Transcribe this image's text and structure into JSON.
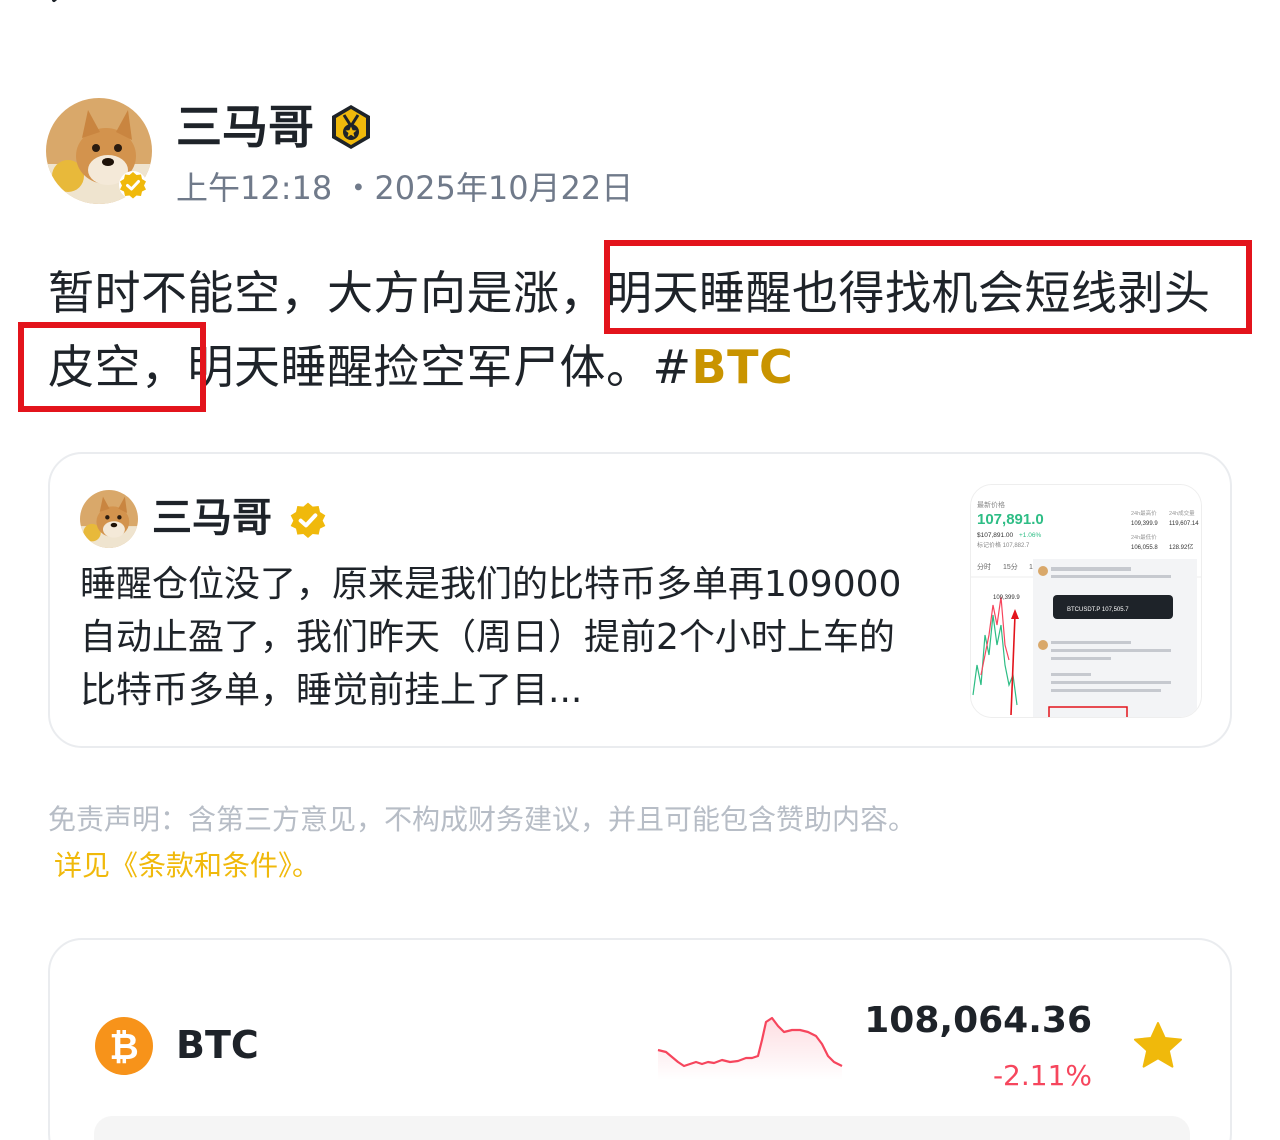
{
  "nav": {
    "back_icon": "chevron-left-icon"
  },
  "post": {
    "author": "三马哥",
    "author_badge_icon": "medal-icon",
    "verified_icon": "verified-check-icon",
    "time": "上午12:18 ・2025年10月22日",
    "body_text": "暂时不能空，大方向是涨，明天睡醒也得找机会短线剥头皮空，明天睡醒捡空军尸体。#",
    "hashtag": "BTC"
  },
  "quote": {
    "author": "三马哥",
    "text": "睡醒仓位没了，原来是我们的比特币多单再109000自动止盈了，我们昨天（周日）提前2个小时上车的比特币多单，睡觉前挂上了目...",
    "thumbnail": {
      "label_price": "最新价格",
      "price": "107,891.0",
      "sub_price": "$107,891.00",
      "change": "+1.06%",
      "mark_label": "标记价格 107,882.7",
      "high_label": "24h最高价",
      "high": "109,399.9",
      "low_label": "24h最低价",
      "low": "106,055.8",
      "vol_label": "24h成交量",
      "vol1": "119,607.14",
      "vol2": "128.92亿",
      "tabs": [
        "分时",
        "15分",
        "1小"
      ],
      "chart_marker": "109,399.9",
      "ticker_pill": "BTCUSDT.P 107,505.7"
    }
  },
  "disclaimer": {
    "text": "免责声明：含第三方意见，不构成财务建议，并且可能包含赞助内容。",
    "link": "详见《条款和条件》。"
  },
  "coin": {
    "symbol": "BTC",
    "icon": "bitcoin-icon",
    "price": "108,064.36",
    "change": "-2.11%",
    "fav_icon": "star-icon",
    "colors": {
      "down": "#f6465d",
      "star": "#f0b90b",
      "bitcoin": "#f7931a"
    }
  }
}
